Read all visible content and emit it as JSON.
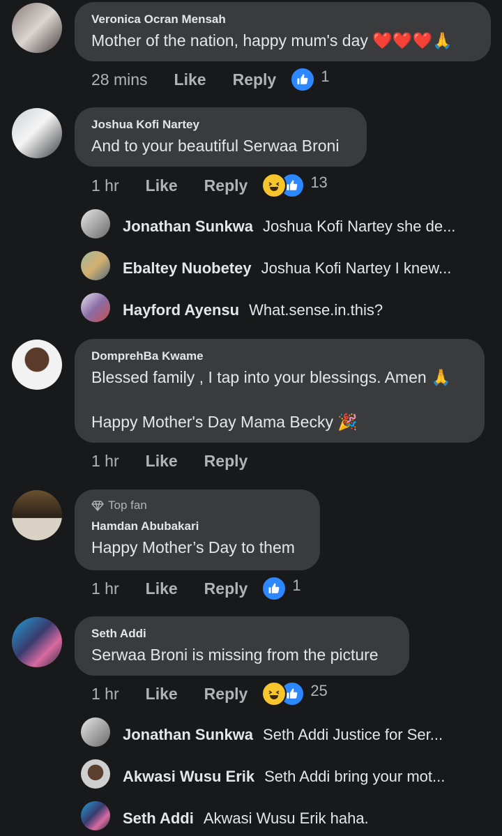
{
  "comments": [
    {
      "author": "Veronica Ocran Mensah",
      "text": "Mother of the nation, happy mum's day ❤️❤️❤️🙏",
      "time": "28 mins",
      "like_label": "Like",
      "reply_label": "Reply",
      "reactions": [
        "like"
      ],
      "reaction_count": "1"
    },
    {
      "author": "Joshua Kofi Nartey",
      "text": "And to your beautiful Serwaa Broni",
      "time": "1 hr",
      "like_label": "Like",
      "reply_label": "Reply",
      "reactions": [
        "haha",
        "like"
      ],
      "reaction_count": "13",
      "replies": [
        {
          "author": "Jonathan Sunkwa",
          "text": "Joshua Kofi Nartey she de..."
        },
        {
          "author": "Ebaltey Nuobetey",
          "text": "Joshua Kofi Nartey I knew..."
        },
        {
          "author": "Hayford Ayensu",
          "text": "What.sense.in.this?"
        }
      ]
    },
    {
      "author": "DomprehBa Kwame",
      "text_line1": "Blessed family , I tap into your blessings. Amen 🙏",
      "text_line2": "Happy Mother's Day Mama Becky 🎉",
      "time": "1 hr",
      "like_label": "Like",
      "reply_label": "Reply"
    },
    {
      "badge": "Top fan",
      "author": "Hamdan Abubakari",
      "text": "Happy Mother’s Day to them",
      "time": "1 hr",
      "like_label": "Like",
      "reply_label": "Reply",
      "reactions": [
        "like"
      ],
      "reaction_count": "1"
    },
    {
      "author": "Seth Addi",
      "text": "Serwaa Broni is missing from the picture",
      "time": "1 hr",
      "like_label": "Like",
      "reply_label": "Reply",
      "reactions": [
        "haha",
        "like"
      ],
      "reaction_count": "25",
      "replies": [
        {
          "author": "Jonathan Sunkwa",
          "text": "Seth Addi Justice for Ser..."
        },
        {
          "author": "Akwasi Wusu Erik",
          "text": "Seth Addi  bring your mot..."
        },
        {
          "author": "Seth Addi",
          "text": "Akwasi Wusu Erik haha."
        }
      ]
    }
  ],
  "colors": {
    "background": "#18191a",
    "bubble": "#3a3b3c",
    "like_blue": "#2d88ff",
    "haha_yellow": "#f7c52c"
  }
}
